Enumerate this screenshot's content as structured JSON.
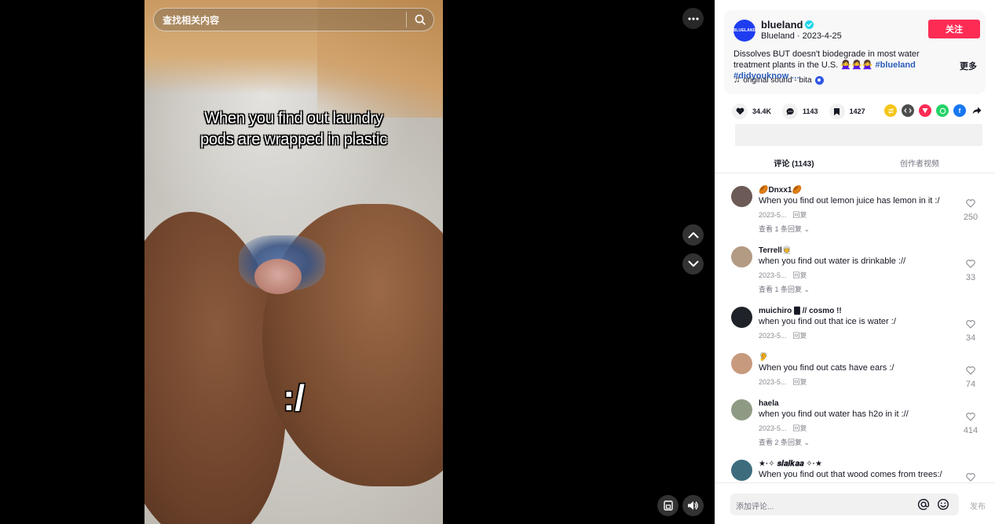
{
  "search": {
    "placeholder": "查找相关内容"
  },
  "video": {
    "caption_line1": "When you find out laundry",
    "caption_line2": "pods are wrapped in plastic",
    "caption_face": ":/"
  },
  "author": {
    "avatar_text": "BLUELAND",
    "name": "blueland",
    "subtitle": "Blueland · 2023-4-25",
    "follow_label": "关注",
    "description": "Dissolves BUT doesn't biodegrade in most water treatment plants in the U.S. 🙅‍♀️🙅‍♀️🙅‍♀️",
    "tags": "#blueland #didyouknow …",
    "more_label": "更多",
    "sound": "original sound - bita"
  },
  "actions": {
    "likes": "34.4K",
    "comments": "1143",
    "saves": "1427"
  },
  "share_colors": {
    "first": "#f5c518",
    "embed": "#4d4d4d",
    "send": "#fe2c55",
    "whatsapp": "#25d366",
    "facebook": "#1877f2"
  },
  "tabs": {
    "comments": "评论 (1143)",
    "creator_videos": "创作者视频"
  },
  "comments": [
    {
      "user": "🏉Dnxx1🏉",
      "text": "When you find out lemon juice has lemon in it :/",
      "date": "2023-5...",
      "reply": "回复",
      "view": "查看 1 条回复 ⌄",
      "likes": "250",
      "avatar_color": "#6b5a55"
    },
    {
      "user": "Terrell👳",
      "text": "when you find out water is drinkable ://",
      "date": "2023-5...",
      "reply": "回复",
      "view": "查看 1 条回复 ⌄",
      "likes": "33",
      "avatar_color": "#b39a83"
    },
    {
      "user": "muichiro 🀫 // cosmo !!",
      "text": "when you find out that ice is water :/",
      "date": "2023-5...",
      "reply": "回复",
      "view": "",
      "likes": "34",
      "avatar_color": "#1f2228"
    },
    {
      "user": "🦻",
      "text": "When you find out cats have ears :/",
      "date": "2023-5...",
      "reply": "回复",
      "view": "",
      "likes": "74",
      "avatar_color": "#c89a7d"
    },
    {
      "user": "haela",
      "text": "when you find out water has h2o in it ://",
      "date": "2023-5...",
      "reply": "回复",
      "view": "查看 2 条回复 ⌄",
      "likes": "414",
      "avatar_color": "#8f9a84"
    },
    {
      "user": "★·✧ 𝒔𝒍𝒂𝒊𝒌𝒂𝒂 ✧·★",
      "text": "When you find out that wood comes from trees:/",
      "date": "",
      "reply": "",
      "view": "",
      "likes": "",
      "avatar_color": "#3d6d7c"
    }
  ],
  "comment_bar": {
    "placeholder": "添加评论...",
    "post_label": "发布"
  }
}
